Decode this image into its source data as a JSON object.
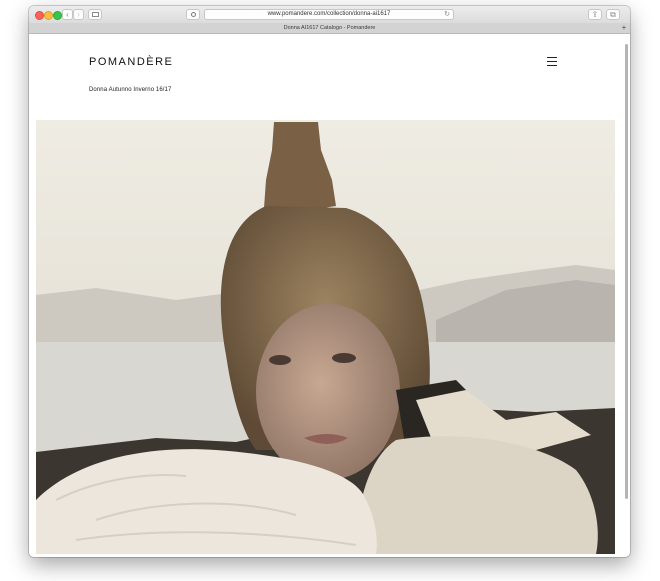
{
  "browser": {
    "url": "www.pomandere.com/collection/donna-ai1617",
    "tab_title": "Donna AI1617 Catalogo - Pomandere",
    "back_glyph": "‹",
    "forward_glyph": "›",
    "reload_glyph": "↻",
    "share_glyph": "⇪",
    "tabs_glyph": "⧉",
    "newtab_glyph": "+"
  },
  "site": {
    "logo": "POMANDÈRE",
    "subtitle": "Donna Autunno Inverno 16/17"
  },
  "hero": {
    "icon": "photo-icon",
    "colors": {
      "sky": "#e6e1d6",
      "mountain": "#c9c3bb",
      "water": "#d8d6d0",
      "shore": "#3a352f",
      "hair": "#7d6446",
      "skin": "#b89a86",
      "fur": "#ece6dc",
      "sweater": "#ddd5c6"
    }
  }
}
